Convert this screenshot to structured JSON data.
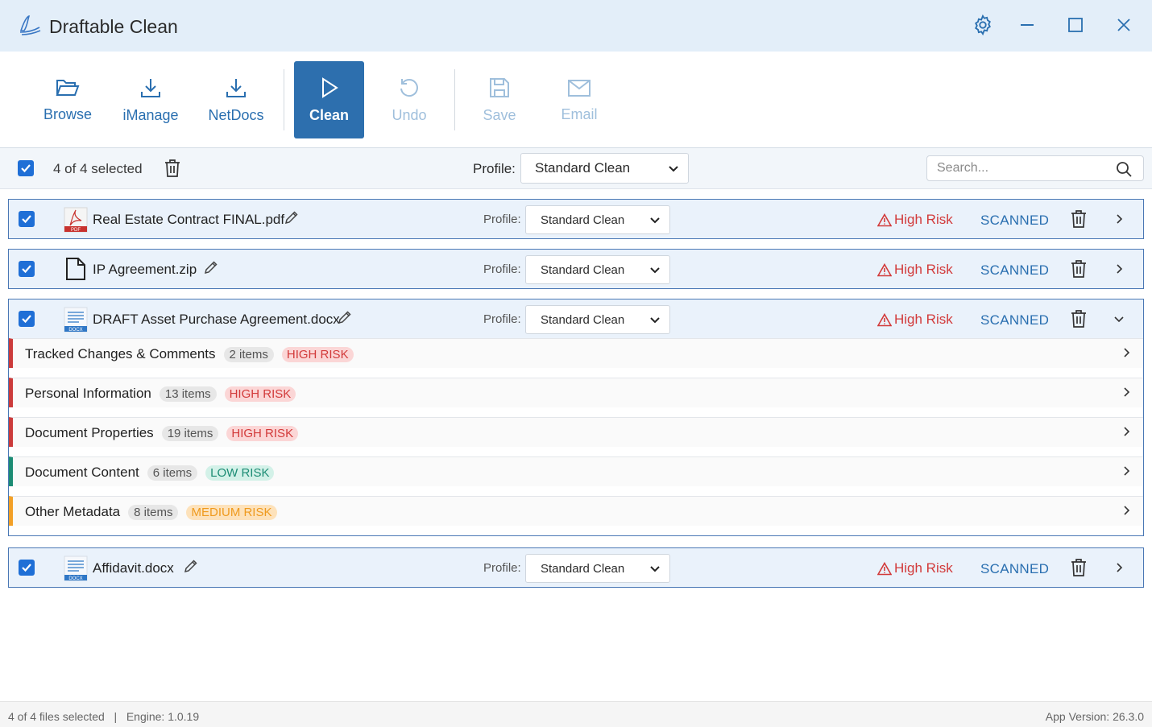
{
  "window": {
    "title": "Draftable Clean"
  },
  "toolbar": {
    "browse": "Browse",
    "imanage": "iManage",
    "netdocs": "NetDocs",
    "clean": "Clean",
    "undo": "Undo",
    "save": "Save",
    "email": "Email"
  },
  "selection": {
    "count_text": "4 of 4 selected",
    "profile_label": "Profile:",
    "profile_value": "Standard Clean",
    "search_placeholder": "Search..."
  },
  "files": [
    {
      "name": "Real Estate Contract FINAL.pdf",
      "type": "pdf",
      "type_label": "PDF",
      "profile_label": "Profile:",
      "profile": "Standard Clean",
      "risk": "High Risk",
      "status": "SCANNED",
      "expanded": false
    },
    {
      "name": "IP Agreement.zip",
      "type": "zip",
      "profile_label": "Profile:",
      "profile": "Standard Clean",
      "risk": "High Risk",
      "status": "SCANNED",
      "expanded": false
    },
    {
      "name": "DRAFT Asset Purchase Agreement.docx",
      "type": "docx",
      "type_label": "DOCX",
      "profile_label": "Profile:",
      "profile": "Standard Clean",
      "risk": "High Risk",
      "status": "SCANNED",
      "expanded": true
    },
    {
      "name": "Affidavit.docx",
      "type": "docx",
      "type_label": "DOCX",
      "profile_label": "Profile:",
      "profile": "Standard Clean",
      "risk": "High Risk",
      "status": "SCANNED",
      "expanded": false
    }
  ],
  "categories": [
    {
      "title": "Tracked Changes & Comments",
      "count": "2 items",
      "risk": "HIGH RISK",
      "color": "#cc3b3b",
      "pill_bg": "#fbd6d6",
      "pill_fg": "#d23a3a"
    },
    {
      "title": "Personal Information",
      "count": "13 items",
      "risk": "HIGH RISK",
      "color": "#cc3b3b",
      "pill_bg": "#fbd6d6",
      "pill_fg": "#d23a3a"
    },
    {
      "title": "Document Properties",
      "count": "19 items",
      "risk": "HIGH RISK",
      "color": "#cc3b3b",
      "pill_bg": "#fbd6d6",
      "pill_fg": "#d23a3a"
    },
    {
      "title": "Document Content",
      "count": "6 items",
      "risk": "LOW RISK",
      "color": "#1c8c74",
      "pill_bg": "#d3f1e8",
      "pill_fg": "#1c8c74"
    },
    {
      "title": "Other Metadata",
      "count": "8 items",
      "risk": "MEDIUM RISK",
      "color": "#f3a027",
      "pill_bg": "#fde2bb",
      "pill_fg": "#ef9a1e"
    }
  ],
  "statusbar": {
    "left": "4 of 4 files selected   |   Engine: 1.0.19",
    "right": "App Version: 26.3.0"
  },
  "colors": {
    "accent": "#2d6fae",
    "checkbox": "#1f6fd6",
    "high_risk": "#d23a3a",
    "scanned": "#2a6fb0"
  }
}
